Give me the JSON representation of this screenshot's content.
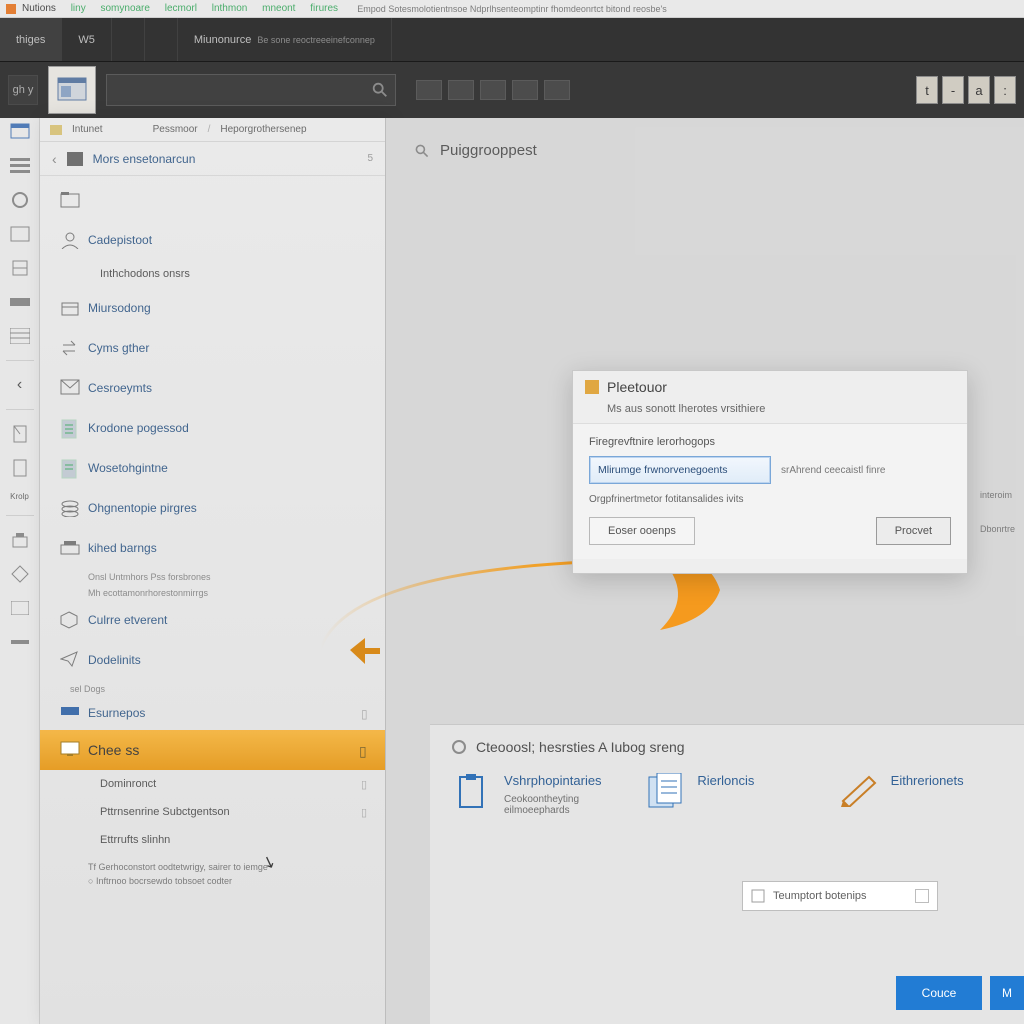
{
  "titlebar": {
    "app": "Nutions",
    "menus": [
      "liny",
      "somynoare",
      "lecmorl",
      "lnthmon",
      "mneont",
      "firures"
    ],
    "center": "Empod  Sotesmolotientnsoe  Ndprlhsenteomptinr  fhomdeonrtct bitond reosbe's"
  },
  "ribbon": {
    "tabs": [
      "thiges",
      "W5",
      "",
      "",
      "Miunonurce"
    ],
    "subtext": "Be sone reoctreeeinefconnep"
  },
  "toolbar": {
    "left_label": "gh  y",
    "right_controls": [
      "t",
      "-",
      "a",
      ":"
    ]
  },
  "sidebar": {
    "breadcrumb": [
      "Intunet",
      "Pessmoor",
      "Heporgrothersenep"
    ],
    "back": "‹",
    "title": "Mors ensetonarcun",
    "count": "5",
    "items": [
      {
        "icon": "folder",
        "label": ""
      },
      {
        "icon": "user",
        "label": "Cadepistoot"
      },
      {
        "icon": "note",
        "label": "Inthchodons onsrs",
        "sub": true
      },
      {
        "icon": "box",
        "label": "Miursodong"
      },
      {
        "icon": "swap",
        "label": "Cyms gther"
      },
      {
        "icon": "mail",
        "label": "Cesroeymts"
      },
      {
        "icon": "doc",
        "label": "Krodone pogessod"
      },
      {
        "icon": "doc",
        "label": "Wosetohgintne"
      },
      {
        "icon": "stack",
        "label": "Ohgnentopie pirgres"
      },
      {
        "icon": "tray",
        "label": "kihed barngs"
      }
    ],
    "section_a": "Onsl Untmhors  Pss  forsbrones",
    "section_b": "Mh ecottamonrhorestonmirrgs",
    "lower": [
      {
        "icon": "cube",
        "label": "Culrre etverent"
      },
      {
        "icon": "send",
        "label": "Dodelinits"
      }
    ],
    "group_label": "sel Dogs",
    "group_items": [
      {
        "icon": "drive",
        "label": "Esurnepos",
        "trail": true
      },
      {
        "icon": "screen",
        "label": "Chee ss",
        "selected": true,
        "trail": true
      },
      {
        "icon": "note",
        "label": "Dominronct",
        "sub": true,
        "trail": true
      },
      {
        "icon": "note",
        "label": "Pttrnsenrine Subctgentson",
        "sub": true,
        "trail": true
      },
      {
        "icon": "note",
        "label": "Ettrrufts slinhn",
        "sub": true
      }
    ],
    "footnotes": [
      "Tf  Gerhoconstort oodtetwrigy, sairer to iemge",
      "Inftrnoo bocrsewdo tobsoet codter"
    ]
  },
  "content": {
    "heading": "Puiggrooppest"
  },
  "card": {
    "title": "Pleetouor",
    "subtitle": "Ms aus sonott lherotes vrsithiere",
    "label": "Firegrevftnire lerorhogops",
    "select_value": "Mlirumge frwnorvenegoents",
    "hint": "srAhrend ceecaistl finre",
    "check": "Orgpfrinertmetor fotitansalides ivits",
    "btn_secondary": "Eoser ooenps",
    "btn_primary": "Procvet",
    "side1": "interoim",
    "side2": "Dbonrtre"
  },
  "wizard": {
    "heading": "Cteooosl; hesrsties A Iubog sreng",
    "opts": [
      {
        "title": "Vshrphopintaries",
        "sub": "Ceokoontheyting eilmoeephards",
        "icon": "clipboard"
      },
      {
        "title": "Rierloncis",
        "sub": "",
        "icon": "pages"
      },
      {
        "title": "Eithrerionets",
        "sub": "",
        "icon": "pen"
      }
    ],
    "template_btn": "Teumptort botenips",
    "action_primary": "Couce",
    "action_next": "M"
  }
}
